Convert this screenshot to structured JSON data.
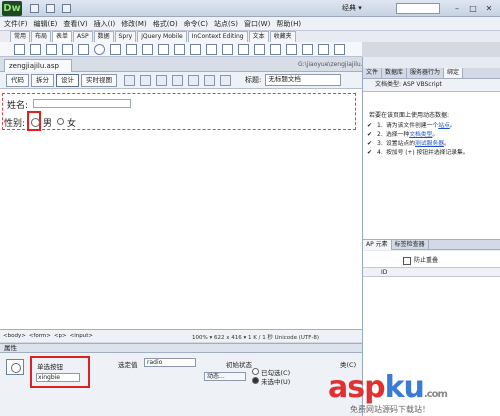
{
  "app": {
    "logo": "Dw",
    "workspace": "经典 ▾"
  },
  "menu": [
    "文件(F)",
    "编辑(E)",
    "查看(V)",
    "插入(I)",
    "修改(M)",
    "格式(O)",
    "命令(C)",
    "站点(S)",
    "窗口(W)",
    "帮助(H)"
  ],
  "insert_tabs": [
    "常用",
    "布局",
    "表单",
    "ASP",
    "数据",
    "Spry",
    "jQuery Mobile",
    "InContext Editing",
    "文本",
    "收藏夹"
  ],
  "insert_active": "表单",
  "document": {
    "tab_name": "zengjiajilu.asp",
    "path": "G:\\jiaoyue\\zengjiajilu.asp",
    "views": [
      "代码",
      "拆分",
      "设计",
      "实时视图"
    ],
    "active_view": "设计",
    "title_label": "标题:",
    "title_value": "无标题文档"
  },
  "form": {
    "name_label": "姓名:",
    "gender_label": "性别:",
    "male": "男",
    "female": "女"
  },
  "status": {
    "tags": [
      "<body>",
      "<form>",
      "<p>",
      "<input>"
    ],
    "right": "100% ▾   622 x 416 ▾   1 K / 1 秒  Unicode (UTF-8)"
  },
  "properties": {
    "header": "属性",
    "radio_label": "单选按钮",
    "radio_name": "xingbie",
    "checked_value_label": "选定值",
    "checked_value": "radio",
    "initial_state_label": "初始状态",
    "option_checked": "已勾选(C)",
    "option_unchecked": "未选中(U)",
    "dynamic_button": "动态...",
    "class_label": "类(C)"
  },
  "right_panel": {
    "tabs": [
      "文件",
      "数据库",
      "服务器行为",
      "绑定"
    ],
    "active_tab": "绑定",
    "doc_type": "文档类型: ASP VBScript",
    "intro": "若要在该页面上使用动态数据:",
    "steps": [
      {
        "num": "1.",
        "text": "请为该文件创建一个",
        "link": "站点",
        "end": "。"
      },
      {
        "num": "2.",
        "text": "选择一种",
        "link": "文档类型",
        "end": "。"
      },
      {
        "num": "3.",
        "text": "设置站点的",
        "link": "测试服务器",
        "end": "。"
      },
      {
        "num": "4.",
        "text": "按加号 (+) 按钮并选择记录集。",
        "link": "",
        "end": ""
      }
    ],
    "ap_tabs": [
      "AP 元素",
      "标签检查器"
    ],
    "prevent_overlap": "防止重叠",
    "ap_col_id": "ID"
  },
  "watermark": {
    "brand_red": "asp",
    "brand_blue": "ku",
    "brand_suffix": ".com",
    "caption": "免费网站源码下载站！"
  },
  "colors": {
    "highlight_red": "#e02020",
    "link_blue": "#2050c0"
  }
}
